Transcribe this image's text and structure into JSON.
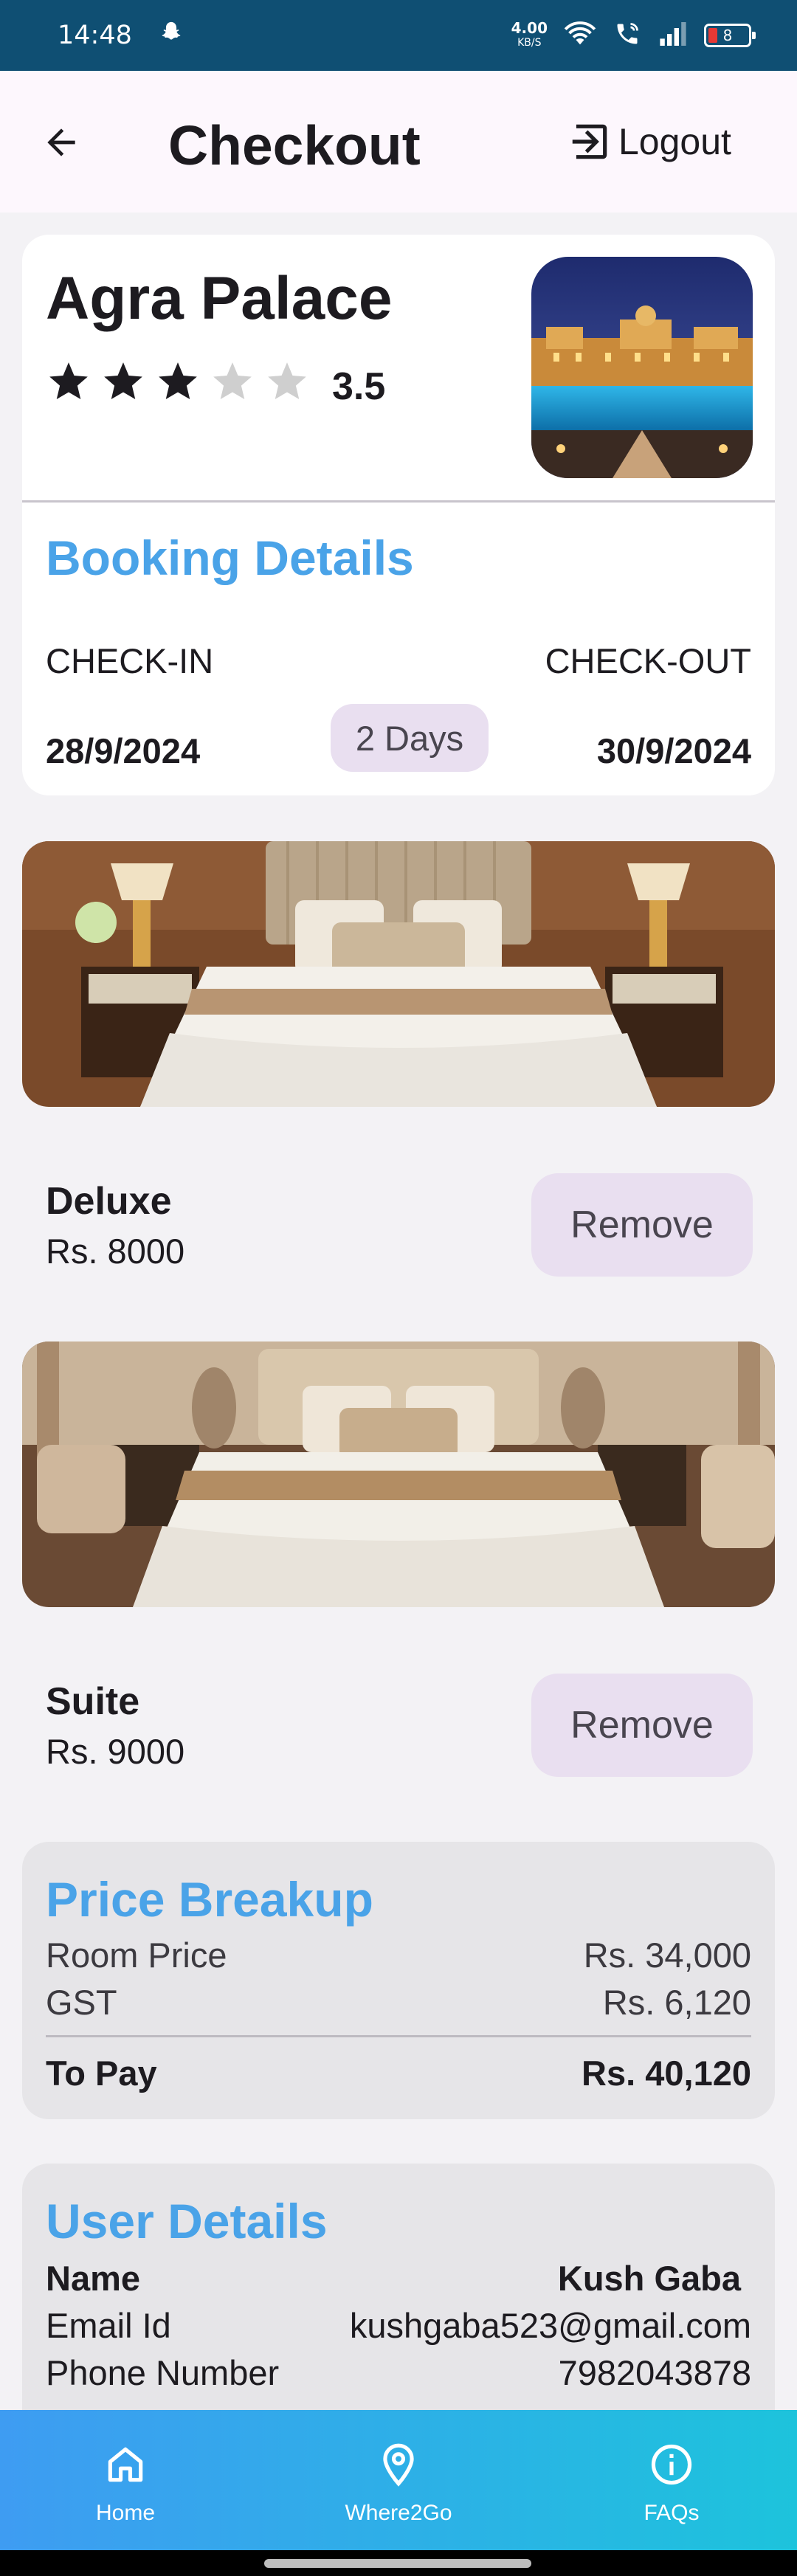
{
  "status_bar": {
    "time": "14:48",
    "net_speed": "4.00",
    "net_unit": "KB/S",
    "battery": "8"
  },
  "app_bar": {
    "title": "Checkout",
    "logout_label": "Logout"
  },
  "hotel": {
    "name": "Agra Palace",
    "rating": "3.5",
    "rating_value": 3.5,
    "rating_max": 5
  },
  "booking": {
    "heading": "Booking Details",
    "checkin_label": "CHECK-IN",
    "checkout_label": "CHECK-OUT",
    "checkin_date": "28/9/2024",
    "checkout_date": "30/9/2024",
    "duration": "2 Days"
  },
  "rooms": [
    {
      "name": "Deluxe",
      "price": "Rs. 8000",
      "remove_label": "Remove"
    },
    {
      "name": "Suite",
      "price": "Rs. 9000",
      "remove_label": "Remove"
    }
  ],
  "price_breakup": {
    "heading": "Price Breakup",
    "room_price_label": "Room Price",
    "room_price": "Rs. 34,000",
    "gst_label": "GST",
    "gst": "Rs. 6,120",
    "total_label": "To Pay",
    "total": "Rs. 40,120"
  },
  "user_details": {
    "heading": "User Details",
    "name_label": "Name",
    "name": "Kush Gaba",
    "email_label": "Email Id",
    "email": "kushgaba523@gmail.com",
    "phone_label": "Phone Number",
    "phone": "7982043878"
  },
  "nav": [
    {
      "label": "Home",
      "icon": "home-icon"
    },
    {
      "label": "Where2Go",
      "icon": "location-pin-icon"
    },
    {
      "label": "FAQs",
      "icon": "info-icon"
    }
  ],
  "colors": {
    "accent": "#4aa3e8",
    "status_bar": "#0f4f73",
    "chip": "#e9dff0"
  }
}
